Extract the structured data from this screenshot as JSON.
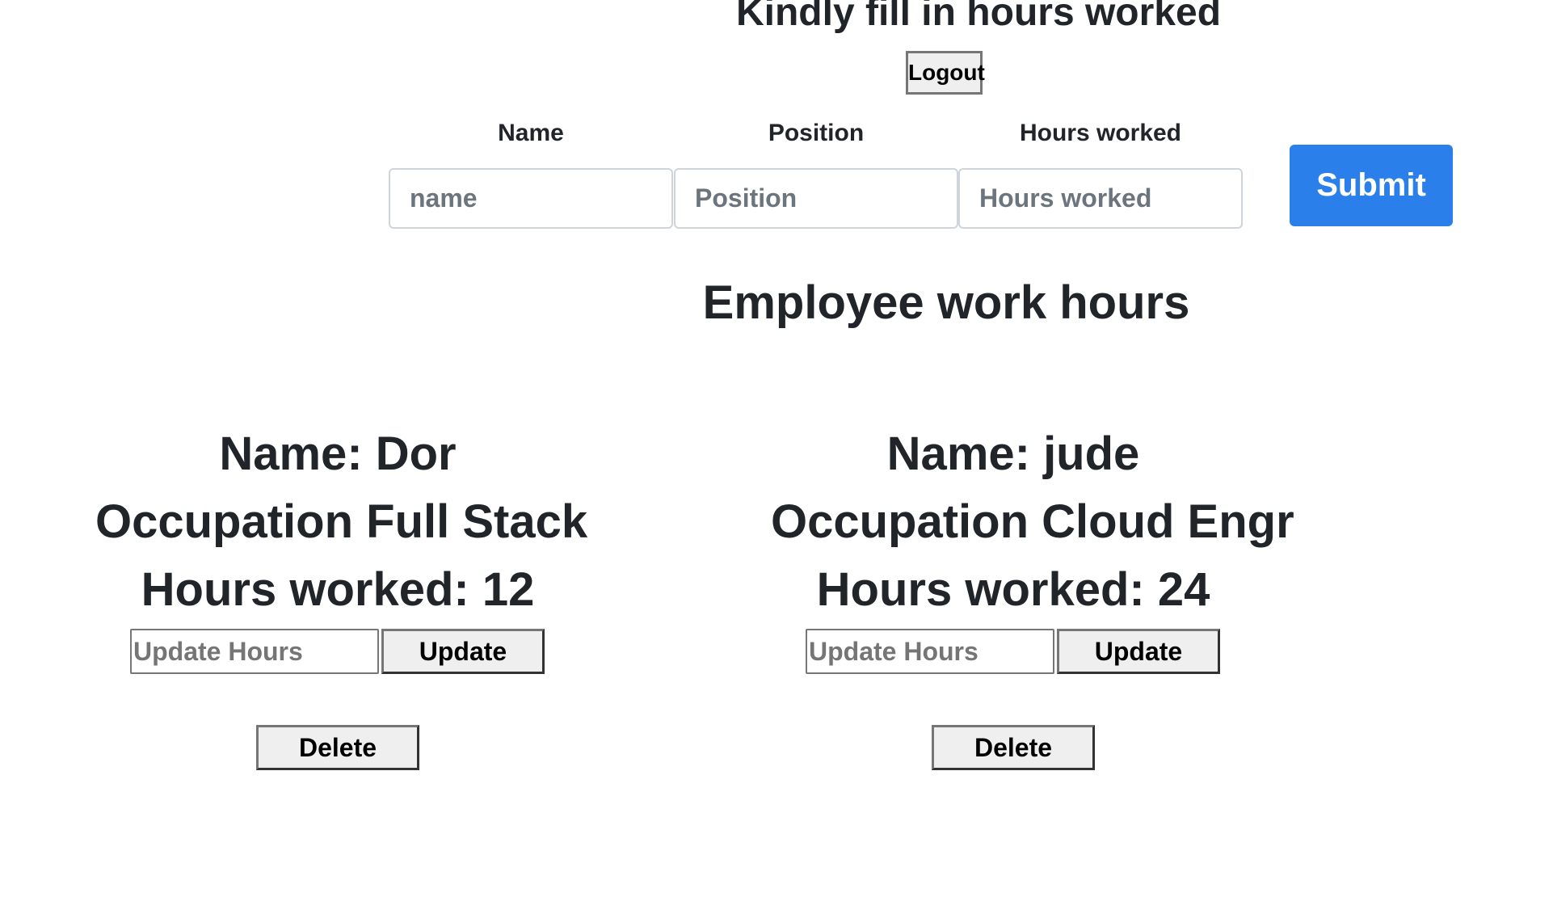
{
  "header": {
    "title": "Kindly fill in hours worked",
    "logout_label": "Logout"
  },
  "form": {
    "name_label": "Name",
    "name_placeholder": "name",
    "position_label": "Position",
    "position_placeholder": "Position",
    "hours_label": "Hours worked",
    "hours_placeholder": "Hours worked",
    "submit_label": "Submit"
  },
  "list": {
    "title": "Employee work hours",
    "employees": [
      {
        "name_line": "Name: Dor",
        "occupation_line": "Occupation Full Stack",
        "hours_line": "Hours worked: 12",
        "update_placeholder": "Update Hours",
        "update_label": "Update",
        "delete_label": "Delete"
      },
      {
        "name_line": "Name: jude",
        "occupation_line": "Occupation Cloud Engr",
        "hours_line": "Hours worked: 24",
        "update_placeholder": "Update Hours",
        "update_label": "Update",
        "delete_label": "Delete"
      }
    ]
  },
  "colors": {
    "submit_bg": "#2b7fea",
    "text": "#212529"
  }
}
